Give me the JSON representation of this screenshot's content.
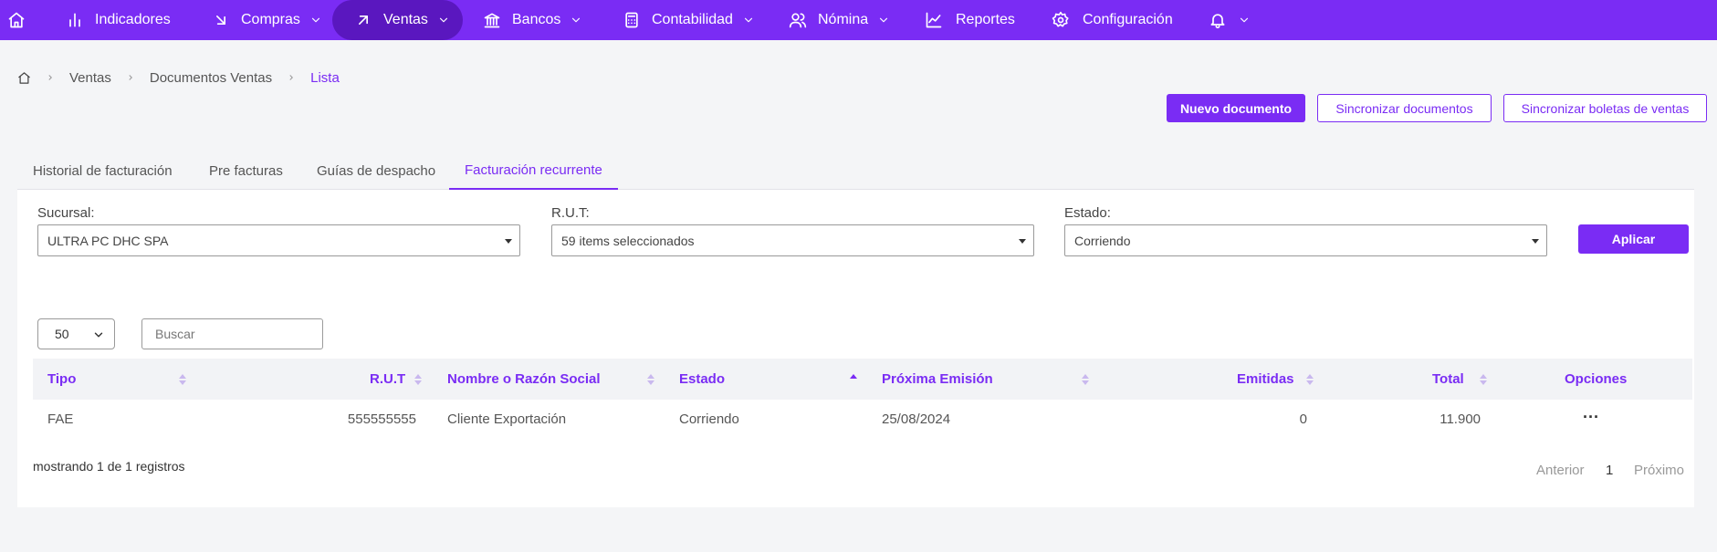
{
  "nav": {
    "items": [
      {
        "label": "Indicadores",
        "icon": "bar-chart-icon"
      },
      {
        "label": "Compras",
        "icon": "arrow-down-right-icon"
      },
      {
        "label": "Ventas",
        "icon": "arrow-up-right-icon"
      },
      {
        "label": "Bancos",
        "icon": "bank-icon"
      },
      {
        "label": "Contabilidad",
        "icon": "calculator-icon"
      },
      {
        "label": "Nómina",
        "icon": "users-icon"
      },
      {
        "label": "Reportes",
        "icon": "line-chart-icon"
      },
      {
        "label": "Configuración",
        "icon": "settings-icon"
      }
    ],
    "active": "Ventas",
    "accent": "#7a2cf4"
  },
  "breadcrumb": {
    "items": [
      "Ventas",
      "Documentos Ventas"
    ],
    "current": "Lista"
  },
  "actions": {
    "new_doc": "Nuevo documento",
    "sync_docs": "Sincronizar documentos",
    "sync_boletas": "Sincronizar boletas de ventas"
  },
  "tabs": [
    {
      "label": "Historial de facturación"
    },
    {
      "label": "Pre facturas"
    },
    {
      "label": "Guías de despacho"
    },
    {
      "label": "Facturación recurrente"
    }
  ],
  "active_tab": "Facturación recurrente",
  "filters": {
    "sucursal": {
      "label": "Sucursal:",
      "value": "ULTRA PC DHC SPA"
    },
    "rut": {
      "label": "R.U.T:",
      "value": "59 items seleccionados"
    },
    "estado": {
      "label": "Estado:",
      "value": "Corriendo"
    },
    "apply": "Aplicar"
  },
  "list": {
    "per_page": "50",
    "search_placeholder": "Buscar"
  },
  "table": {
    "columns": [
      "Tipo",
      "R.U.T",
      "Nombre o Razón Social",
      "Estado",
      "Próxima Emisión",
      "Emitidas",
      "Total",
      "Opciones"
    ],
    "sorted_column": "Estado",
    "rows": [
      {
        "tipo": "FAE",
        "rut": "555555555",
        "nombre": "Cliente Exportación",
        "estado": "Corriendo",
        "proxima": "25/08/2024",
        "emitidas": "0",
        "total": "11.900",
        "opciones": "···"
      }
    ]
  },
  "footer": {
    "records": "mostrando 1 de 1 registros",
    "prev": "Anterior",
    "page": "1",
    "next": "Próximo"
  }
}
